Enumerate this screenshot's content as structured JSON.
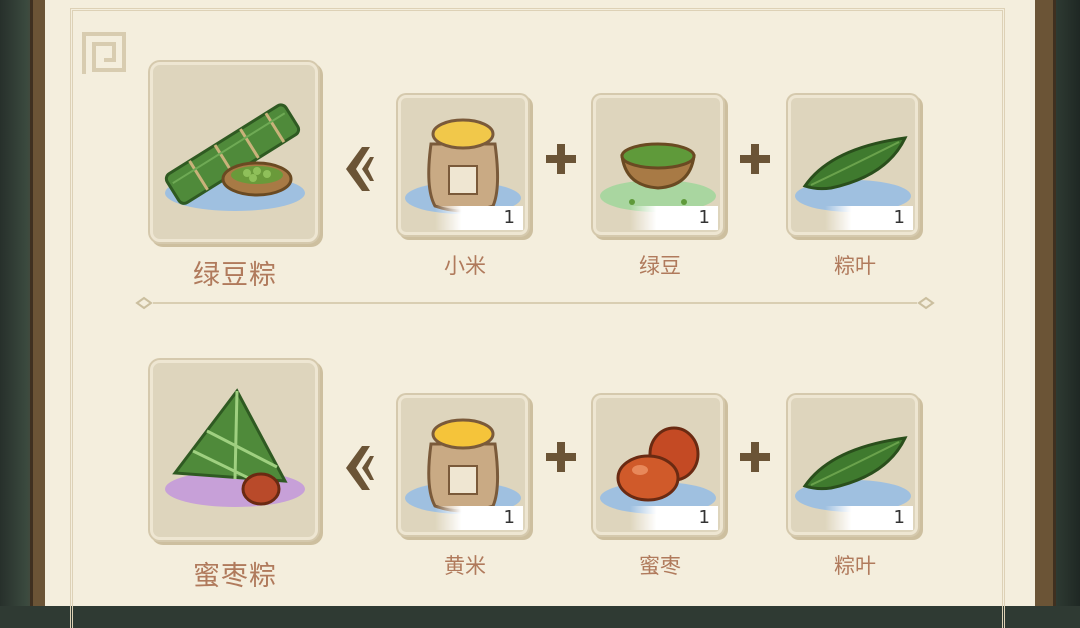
{
  "recipes": [
    {
      "product": {
        "name": "绿豆粽",
        "icon": "mung-bean-zongzi-icon",
        "glow": "#9fc0e0"
      },
      "ingredients": [
        {
          "name": "小米",
          "count": "1",
          "icon": "millet-sack-icon",
          "glow": "#9fc0e0"
        },
        {
          "name": "绿豆",
          "count": "1",
          "icon": "mung-bean-bowl-icon",
          "glow": "#a9d6a0"
        },
        {
          "name": "粽叶",
          "count": "1",
          "icon": "bamboo-leaf-icon",
          "glow": "#9fc0e0"
        }
      ]
    },
    {
      "product": {
        "name": "蜜枣粽",
        "icon": "date-zongzi-icon",
        "glow": "#c7a0d8"
      },
      "ingredients": [
        {
          "name": "黄米",
          "count": "1",
          "icon": "yellow-rice-sack-icon",
          "glow": "#9fc0e0"
        },
        {
          "name": "蜜枣",
          "count": "1",
          "icon": "candied-date-icon",
          "glow": "#9fc0e0"
        },
        {
          "name": "粽叶",
          "count": "1",
          "icon": "bamboo-leaf-icon",
          "glow": "#9fc0e0"
        }
      ]
    }
  ],
  "colors": {
    "panel": "#f4eedd",
    "card": "#ded5bd",
    "label": "#b07a5c",
    "ornament": "#6b5436"
  }
}
